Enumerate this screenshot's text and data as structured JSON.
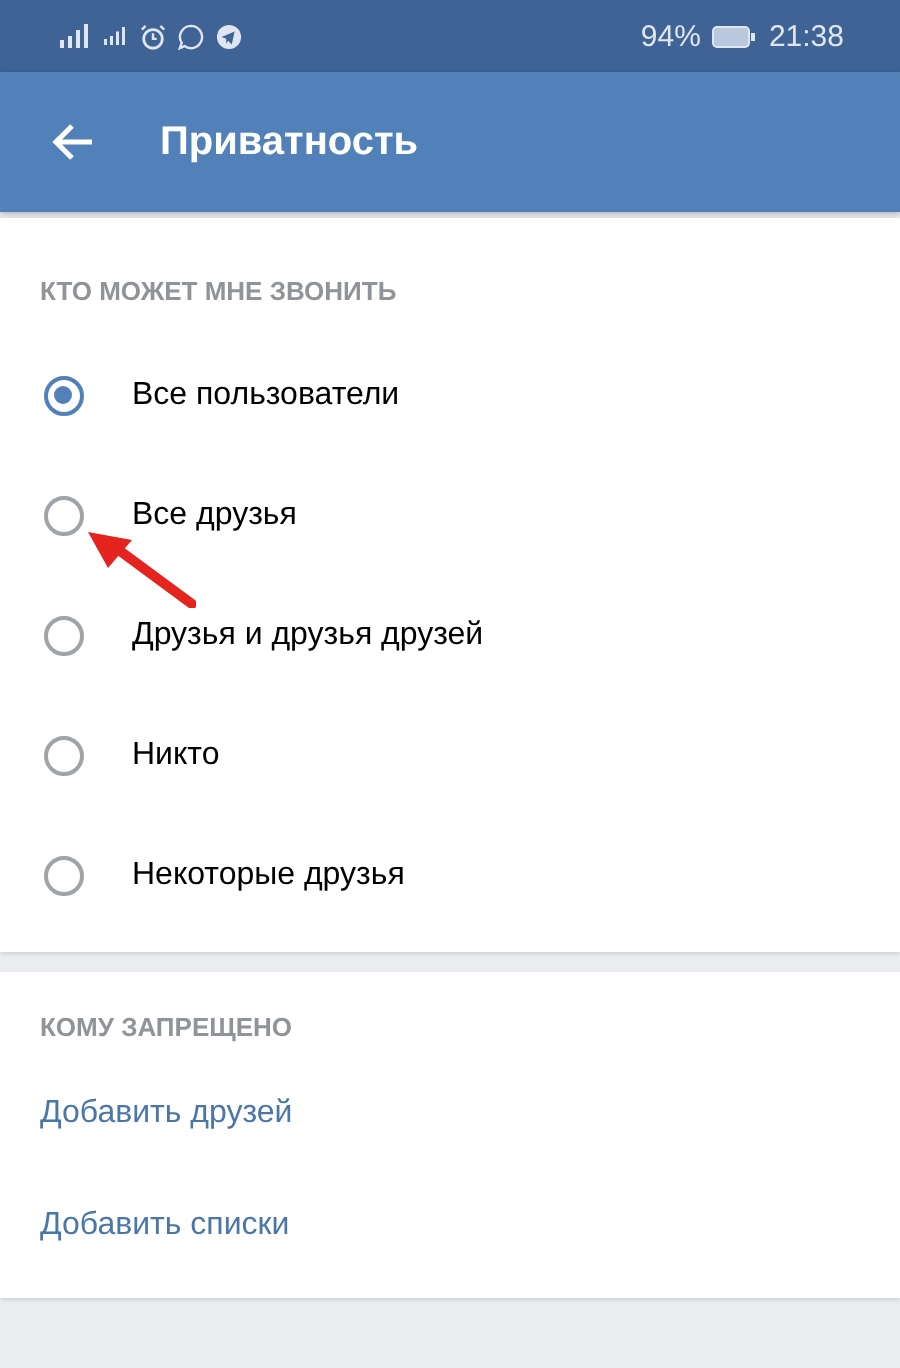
{
  "status_bar": {
    "battery": "94%",
    "time": "21:38"
  },
  "header": {
    "title": "Приватность"
  },
  "sections": [
    {
      "title": "КТО МОЖЕТ МНЕ ЗВОНИТЬ",
      "kind": "radio",
      "items": [
        {
          "label": "Все пользователи",
          "selected": true
        },
        {
          "label": "Все друзья",
          "selected": false
        },
        {
          "label": "Друзья и друзья друзей",
          "selected": false
        },
        {
          "label": "Никто",
          "selected": false
        },
        {
          "label": "Некоторые друзья",
          "selected": false
        }
      ]
    },
    {
      "title": "КОМУ ЗАПРЕЩЕНО",
      "kind": "links",
      "items": [
        {
          "label": "Добавить друзей"
        },
        {
          "label": "Добавить списки"
        }
      ]
    }
  ]
}
